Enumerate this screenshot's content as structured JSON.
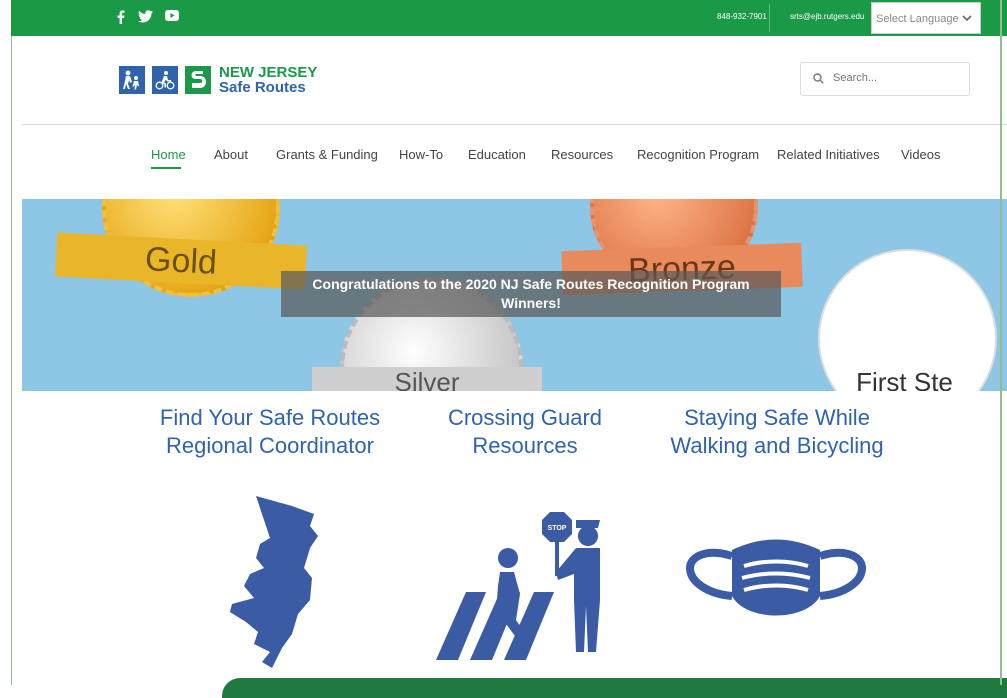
{
  "topbar": {
    "social": [
      {
        "name": "facebook-icon",
        "glyph": "f"
      },
      {
        "name": "twitter-icon",
        "glyph": "twitter"
      },
      {
        "name": "youtube-icon",
        "glyph": "youtube"
      }
    ],
    "phone": "848-932-7901",
    "email": "srts@ejb.rutgers.edu",
    "language_select": "Select Language"
  },
  "header": {
    "logo_line1": "NEW JERSEY",
    "logo_line2": "Safe Routes",
    "search_placeholder": "Search..."
  },
  "nav": {
    "items": [
      "Home",
      "About",
      "Grants & Funding",
      "How-To",
      "Education",
      "Resources",
      "Recognition Program",
      "Related Initiatives",
      "Videos"
    ],
    "active": "Home"
  },
  "banner": {
    "caption": "Congratulations to the 2020 NJ Safe Routes Recognition Program Winners!",
    "medal_gold": "Gold",
    "medal_bronze": "Bronze",
    "medal_silver": "Silver",
    "medal_firststep": "First Ste"
  },
  "features": [
    {
      "title": "Find Your Safe Routes Regional Coordinator",
      "icon": "nj-map-icon"
    },
    {
      "title": "Crossing Guard Resources",
      "icon": "crossing-guard-icon"
    },
    {
      "title": "Staying Safe While Walking and Bicycling",
      "icon": "face-mask-icon"
    }
  ],
  "colors": {
    "green": "#1a9a46",
    "blue": "#2f64ad",
    "banner_sky": "#8ec6e6"
  }
}
